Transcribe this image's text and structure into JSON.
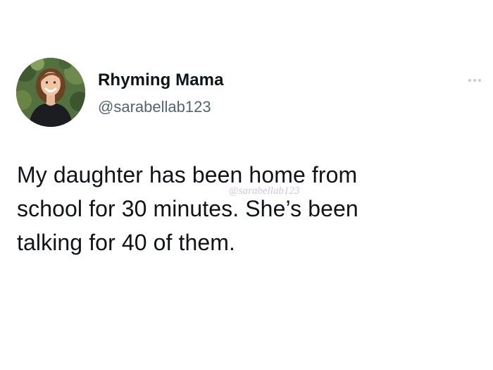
{
  "user": {
    "display_name": "Rhyming Mama",
    "handle": "@sarabellab123"
  },
  "tweet": {
    "lines": [
      "My daughter has been home from",
      "school for 30 minutes. She’s been",
      "talking for 40 of them."
    ]
  },
  "watermark": {
    "text": "@sarabellab123"
  },
  "icons": {
    "more": "more-options-icon",
    "avatar": "profile-photo"
  },
  "colors": {
    "text_primary": "#0f1419",
    "text_secondary": "#536471",
    "watermark": "#c9c0dd",
    "more_dots": "#c8cdd1"
  }
}
